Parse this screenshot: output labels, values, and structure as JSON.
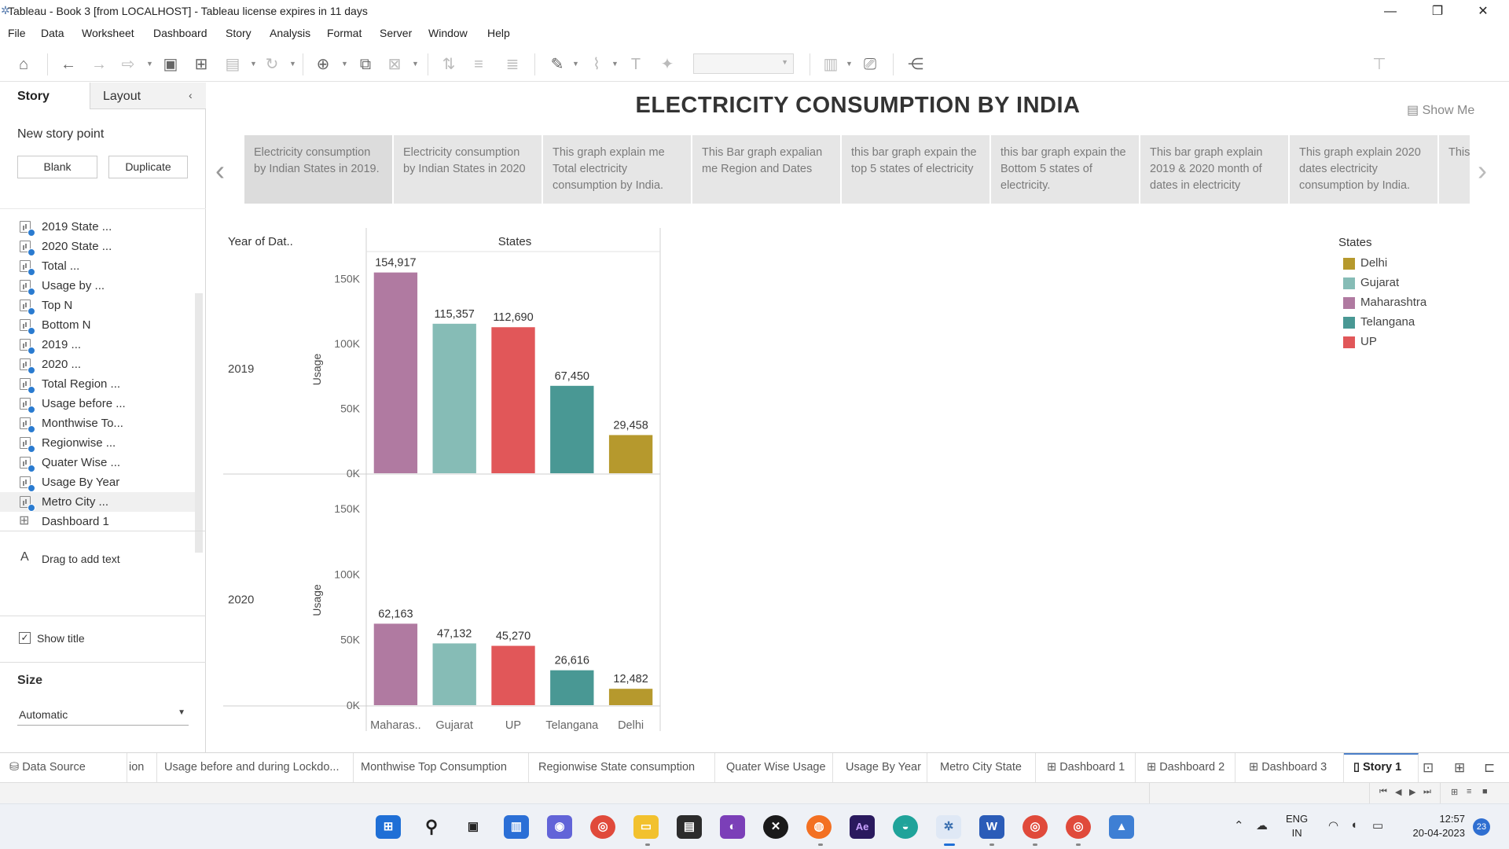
{
  "window": {
    "title": "Tableau - Book 3 [from LOCALHOST] - Tableau license expires in 11 days",
    "minimize": "—",
    "restore": "❐",
    "close": "✕"
  },
  "menu": [
    "File",
    "Data",
    "Worksheet",
    "Dashboard",
    "Story",
    "Analysis",
    "Format",
    "Server",
    "Window",
    "Help"
  ],
  "toolbar": {
    "show_me": "Show Me"
  },
  "left_pane": {
    "tab_story": "Story",
    "tab_layout": "Layout",
    "new_story_point": "New story point",
    "blank_button": "Blank",
    "duplicate_button": "Duplicate",
    "sheets": [
      "2019 State ...",
      "2020 State ...",
      "Total ...",
      "Usage by ...",
      "Top N",
      "Bottom N",
      "2019 ...",
      "2020 ...",
      "Total Region ...",
      "Usage before ...",
      "Monthwise To...",
      "Regionwise ...",
      "Quater Wise ...",
      "Usage By Year",
      "Metro City ...",
      "Dashboard 1"
    ],
    "drag_text": "Drag to add text",
    "show_title": "Show title",
    "size_label": "Size",
    "size_value": "Automatic"
  },
  "story": {
    "title": "ELECTRICITY CONSUMPTION BY INDIA",
    "captions": [
      "Electricity consumption by Indian States in 2019.",
      "Electricity consumption by Indian States in 2020",
      "This graph explain me Total electricity consumption by India.",
      "This Bar graph expalian me Region and Dates",
      "this bar graph expain the top 5 states of electricity",
      "this bar graph expain the Bottom 5 states of electricity.",
      "This bar graph explain 2019 & 2020 month of dates in electricity",
      "This graph explain 2020 dates electricity consumption by India.",
      "This ... the elec..."
    ]
  },
  "chart_data": {
    "type": "bar",
    "title": "",
    "row_header": "Year of Dat..",
    "column_header": "States",
    "ylabel": "Usage",
    "categories": [
      "Maharas..",
      "Gujarat",
      "UP",
      "Telangana",
      "Delhi"
    ],
    "series": [
      {
        "name": "2019",
        "values": [
          154917,
          115357,
          112690,
          67450,
          29458
        ],
        "labels": [
          "154,917",
          "115,357",
          "112,690",
          "67,450",
          "29,458"
        ]
      },
      {
        "name": "2020",
        "values": [
          62163,
          47132,
          45270,
          26616,
          12482
        ],
        "labels": [
          "62,163",
          "47,132",
          "45,270",
          "26,616",
          "12,482"
        ]
      }
    ],
    "yticks": [
      "0K",
      "50K",
      "100K",
      "150K"
    ],
    "ylim": [
      0,
      165000
    ],
    "colors": [
      "#b07aa1",
      "#86bcb6",
      "#e15759",
      "#499894",
      "#b6992d"
    ],
    "legend": {
      "title": "States",
      "position": "right",
      "items": [
        {
          "label": "Delhi",
          "color": "#b6992d"
        },
        {
          "label": "Gujarat",
          "color": "#86bcb6"
        },
        {
          "label": "Maharashtra",
          "color": "#b07aa1"
        },
        {
          "label": "Telangana",
          "color": "#499894"
        },
        {
          "label": "UP",
          "color": "#e15759"
        }
      ]
    }
  },
  "bottom_tabs": {
    "data_source": "Data Source",
    "tabs": [
      "ion",
      "Usage before and during Lockdo...",
      "Monthwise Top Consumption",
      "Regionwise State consumption",
      "Quater Wise Usage",
      "Usage By Year",
      "Metro City State",
      "Dashboard 1",
      "Dashboard 2",
      "Dashboard 3",
      "Story 1"
    ]
  },
  "taskbar": {
    "lang1": "ENG",
    "lang2": "IN",
    "time": "12:57",
    "date": "20-04-2023",
    "badge": "23"
  }
}
